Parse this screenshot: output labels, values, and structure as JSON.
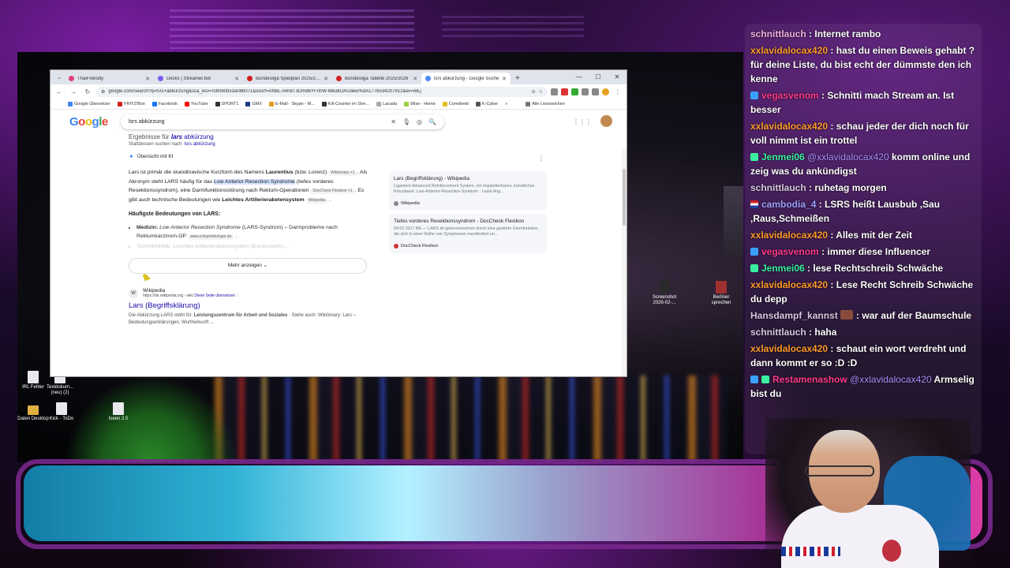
{
  "browser": {
    "tabs": [
      {
        "title": "ThaiFriendly",
        "active": false
      },
      {
        "title": "Decks | Streamer.bot",
        "active": false
      },
      {
        "title": "Bundesliga Spielplan 2025/2026",
        "active": false
      },
      {
        "title": "Bundesliga Tabelle 2025/2026",
        "active": false
      },
      {
        "title": "lsrs abkürzung - Google Suche",
        "active": true
      }
    ],
    "new_tab": "+",
    "url": "google.com/search?q=lsrs+abkürzung&sca_esv=03f060b53a06b071&sxsrf=ANbL-n4n8T3Dmd6YFn0W-Mku8OAUdew%3A1776534207912&ei=v8Lj",
    "bookmarks": [
      "Google Übersetzer",
      "FRITZ!Box",
      "Facebook",
      "YouTube",
      "SPORT1",
      "GMX",
      "E-Mail - Skype - M...",
      "Kill-Counter im Stre...",
      "Lacada",
      "Wise - Home",
      "Comdirekt",
      "K-Cyber"
    ],
    "bookmarks_more": "»",
    "all_bookmarks": "Alle Lesezeichen"
  },
  "google": {
    "query": "lsrs abkürzung",
    "correction_prefix": "Ergebnisse für",
    "correction_term": "lars",
    "correction_suffix": "abkürzung",
    "instead_prefix": "Stattdessen suchen nach:",
    "instead_query": "lsrs abkürzung",
    "ai_label": "Übersicht mit KI",
    "ai_p1_a": "Lars ist primär die skandinavische Kurzform des Namens ",
    "ai_p1_name": "Laurentius",
    "ai_p1_b": " (bzw. Lorenz) ",
    "chip_wiktionary": "Wiktionary +1",
    "ai_p1_c": ". Als Akronym steht LARS häufig für das ",
    "ai_p1_hl": "Low Anterior Resection Syndrome",
    "ai_p1_d": " (tiefes vorderes Resektionssyndrom), eine Darmfunktionsstörung nach Rektum-Operationen ",
    "chip_doccheck": "DocCheck Flexikon +1",
    "ai_p1_e": ". Es gibt auch technische Bedeutungen wie ",
    "ai_p1_bold": "Leichtes Artillerieraketensystem",
    "chip_wikipedia": "Wikipedia",
    "heading": "Häufigste Bedeutungen von LARS:",
    "li1_label": "Medizin:",
    "li1_it": "Low Anterior Resection Syndrome",
    "li1_text": " (LARS-Syndrom) – Darmprobleme nach Rektumkarzinom-OP ",
    "chip_colo": "www.coloproktologie.de",
    "li2": "Technik/Militär: Leichtes Artillerieraketensystem (Bundeswehr) ...",
    "mehr": "Mehr anzeigen",
    "cards": [
      {
        "title": "Lars (Begriffsklärung) - Wikipedia",
        "desc": "Ligament Advanced Reinforcement System, ein implantierbares, künstliches Kreuzband. Low-Anterior-Resection-Syndrom · Least Ang...",
        "source": "Wikipedia"
      },
      {
        "title": "Tiefes vorderes Resektionssyndrom - DocCheck Flexikon",
        "desc": "04.02.2017 BE — LARS ist gekennzeichnet durch eine gestörte Darmfunktion, die sich in einer Reihe von Symptomen manifestiert un...",
        "source": "DocCheck Flexikon"
      }
    ],
    "result": {
      "site": "Wikipedia",
      "url": "https://de.wikipedia.org › wiki",
      "translate": "Diese Seite übersetzen",
      "title": "Lars (Begriffsklärung)",
      "snippet_a": "Die Abkürzung LARS steht für. ",
      "snippet_bold": "Leistungszentrum für Arbeit und Soziales",
      "snippet_b": " · Siehe auch: Wiktionary: Lars – Bedeutungserklärungen, Wortherkunft ..."
    }
  },
  "desktop": {
    "icons": [
      {
        "label": "IRL Fehler"
      },
      {
        "label": "Textdokum... (neu) (2)"
      },
      {
        "label": "Daten Desktop"
      },
      {
        "label": "Kick - ToDo"
      },
      {
        "label": "Iseen 2.0"
      },
      {
        "label": "Screenshot 2026-02-..."
      },
      {
        "label": "Berliner sprechen"
      }
    ]
  },
  "chat": {
    "messages": [
      {
        "user": "schnittlauch",
        "text": ": Internet rambo",
        "color": "pink"
      },
      {
        "user": "xxlavidalocax420",
        "text": ": hast du einen Beweis gehabt ? für deine Liste, du bist echt der dümmste den ich kenne",
        "color": "orange"
      },
      {
        "user": "vegasvenom",
        "text": ": Schnitti mach Stream an. Ist besser",
        "color": "red"
      },
      {
        "user": "xxlavidalocax420",
        "text": ": schau jeder der dich noch für voll nimmt ist ein trottel",
        "color": "orange"
      },
      {
        "user": "Jenmei06",
        "mention": "@xxlavidalocax420",
        "text": " komm online und zeig was du ankündigst",
        "color": "green"
      },
      {
        "user": "schnittlauch",
        "text": ": ruhetag morgen",
        "color": "pink"
      },
      {
        "user": "cambodia_4",
        "text": ": LSRS heißt Lausbub ,Sau ,Raus,Schmeißen",
        "color": "purple"
      },
      {
        "user": "xxlavidalocax420",
        "text": ": Alles mit der Zeit",
        "color": "orange"
      },
      {
        "user": "vegasvenom",
        "text": ": immer diese Influencer",
        "color": "red"
      },
      {
        "user": "Jenmei06",
        "text": ": lese Rechtschreib Schwäche",
        "color": "green"
      },
      {
        "user": "xxlavidalocax420",
        "text": ": Lese Recht Schreib Schwäche du depp",
        "color": "orange"
      },
      {
        "user": "Hansdampf_kannst",
        "text": ": war auf der Baumschule",
        "color": "grey"
      },
      {
        "user": "schnittlauch",
        "text": ": haha",
        "color": "pink"
      },
      {
        "user": "xxlavidalocax420",
        "text": ": schaut ein wort verdreht und dann kommt er so :D :D",
        "color": "orange"
      },
      {
        "user": "Restamenashow",
        "mention": "@xxlavidalocax420",
        "text": " Armselig bist du",
        "color": "red"
      }
    ]
  }
}
